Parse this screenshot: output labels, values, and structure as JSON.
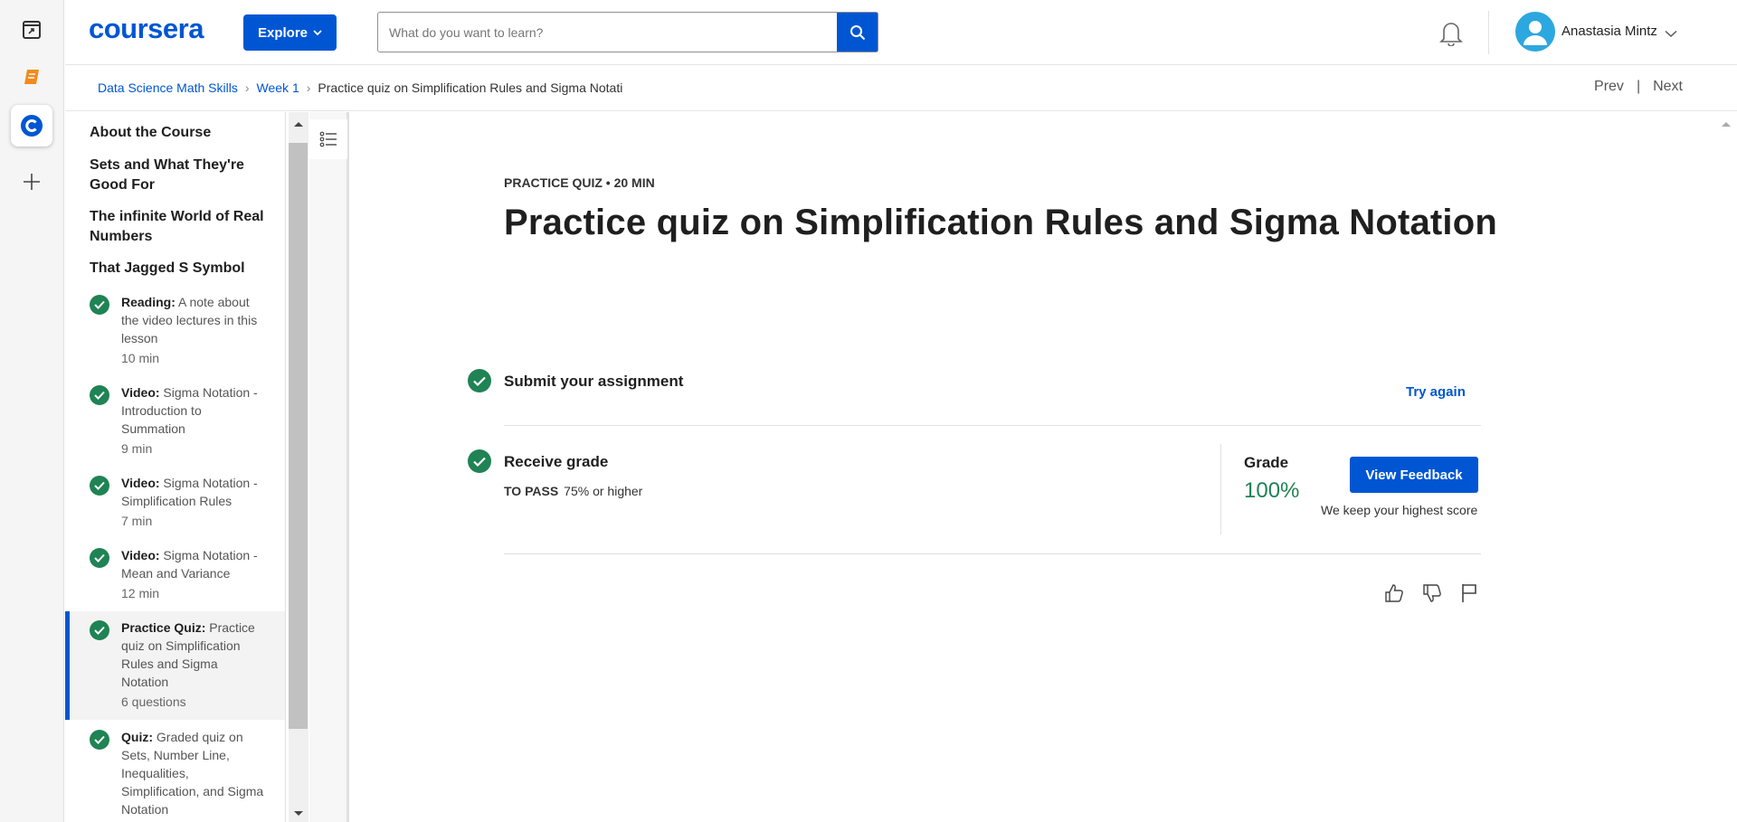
{
  "rail": {
    "icons": [
      "window-icon",
      "book-icon",
      "coursera-app-icon",
      "plus-icon"
    ]
  },
  "header": {
    "logo": "coursera",
    "explore_label": "Explore",
    "search_placeholder": "What do you want to learn?",
    "user_name": "Anastasia Mintz"
  },
  "breadcrumb": {
    "items": [
      "Data Science Math Skills",
      "Week 1"
    ],
    "current": "Practice quiz on Simplification Rules and Sigma Notati"
  },
  "nav": {
    "prev": "Prev",
    "separator": "|",
    "next": "Next"
  },
  "sidebar": {
    "sections": [
      "About the Course",
      "Sets and What They're Good For",
      "The infinite World of Real Numbers",
      "That Jagged S Symbol"
    ],
    "items": [
      {
        "type": "Reading:",
        "title": "A note about the video lectures in this lesson",
        "meta": "10 min"
      },
      {
        "type": "Video:",
        "title": "Sigma Notation - Introduction to Summation",
        "meta": "9 min"
      },
      {
        "type": "Video:",
        "title": "Sigma Notation - Simplification Rules",
        "meta": "7 min"
      },
      {
        "type": "Video:",
        "title": "Sigma Notation - Mean and Variance",
        "meta": "12 min"
      },
      {
        "type": "Practice Quiz:",
        "title": "Practice quiz on Simplification Rules and Sigma Notation",
        "meta": "6 questions"
      },
      {
        "type": "Quiz:",
        "title": "Graded quiz on Sets, Number Line, Inequalities, Simplification, and Sigma Notation",
        "meta": ""
      }
    ]
  },
  "main": {
    "kicker": "PRACTICE QUIZ • 20 MIN",
    "title": "Practice quiz on Simplification Rules and Sigma Notation",
    "step1_title": "Submit your assignment",
    "try_again": "Try again",
    "step2_title": "Receive grade",
    "to_pass_label": "TO PASS",
    "to_pass_value": "75% or higher",
    "grade_label": "Grade",
    "grade_value": "100%",
    "view_feedback": "View Feedback",
    "keep_note": "We keep your highest score"
  },
  "colors": {
    "brand": "#0056d2",
    "success": "#1f8354"
  }
}
